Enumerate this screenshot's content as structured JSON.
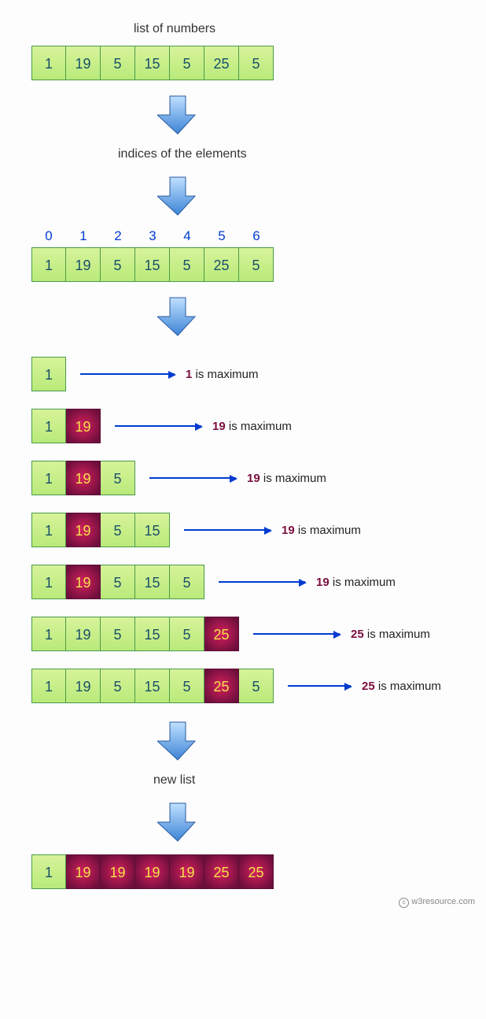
{
  "labels": {
    "list_of_numbers": "list of numbers",
    "indices_label": "indices of the elements",
    "new_list": "new list",
    "is_max": " is maximum"
  },
  "numbers": [
    "1",
    "19",
    "5",
    "15",
    "5",
    "25",
    "5"
  ],
  "indices": [
    "0",
    "1",
    "2",
    "3",
    "4",
    "5",
    "6"
  ],
  "steps": [
    {
      "cells": [
        "1"
      ],
      "hi": [],
      "max": "1",
      "lineW": 120
    },
    {
      "cells": [
        "1",
        "19"
      ],
      "hi": [
        1
      ],
      "max": "19",
      "lineW": 110
    },
    {
      "cells": [
        "1",
        "19",
        "5"
      ],
      "hi": [
        1
      ],
      "max": "19",
      "lineW": 110
    },
    {
      "cells": [
        "1",
        "19",
        "5",
        "15"
      ],
      "hi": [
        1
      ],
      "max": "19",
      "lineW": 110
    },
    {
      "cells": [
        "1",
        "19",
        "5",
        "15",
        "5"
      ],
      "hi": [
        1
      ],
      "max": "19",
      "lineW": 110
    },
    {
      "cells": [
        "1",
        "19",
        "5",
        "15",
        "5",
        "25"
      ],
      "hi": [
        5
      ],
      "max": "25",
      "lineW": 110
    },
    {
      "cells": [
        "1",
        "19",
        "5",
        "15",
        "5",
        "25",
        "5"
      ],
      "hi": [
        5
      ],
      "max": "25",
      "lineW": 80
    }
  ],
  "result": {
    "cells": [
      "1",
      "19",
      "19",
      "19",
      "19",
      "25",
      "25"
    ],
    "hi": [
      1,
      2,
      3,
      4,
      5,
      6
    ]
  },
  "credit": "w3resource.com",
  "chart_data": {
    "type": "table",
    "description": "Running-maximum transformation of a list",
    "input_list": [
      1,
      19,
      5,
      15,
      5,
      25,
      5
    ],
    "indices": [
      0,
      1,
      2,
      3,
      4,
      5,
      6
    ],
    "running_max_per_prefix": [
      {
        "prefix_len": 1,
        "prefix": [
          1
        ],
        "max": 1
      },
      {
        "prefix_len": 2,
        "prefix": [
          1,
          19
        ],
        "max": 19
      },
      {
        "prefix_len": 3,
        "prefix": [
          1,
          19,
          5
        ],
        "max": 19
      },
      {
        "prefix_len": 4,
        "prefix": [
          1,
          19,
          5,
          15
        ],
        "max": 19
      },
      {
        "prefix_len": 5,
        "prefix": [
          1,
          19,
          5,
          15,
          5
        ],
        "max": 19
      },
      {
        "prefix_len": 6,
        "prefix": [
          1,
          19,
          5,
          15,
          5,
          25
        ],
        "max": 25
      },
      {
        "prefix_len": 7,
        "prefix": [
          1,
          19,
          5,
          15,
          5,
          25,
          5
        ],
        "max": 25
      }
    ],
    "output_list": [
      1,
      19,
      19,
      19,
      19,
      25,
      25
    ]
  }
}
